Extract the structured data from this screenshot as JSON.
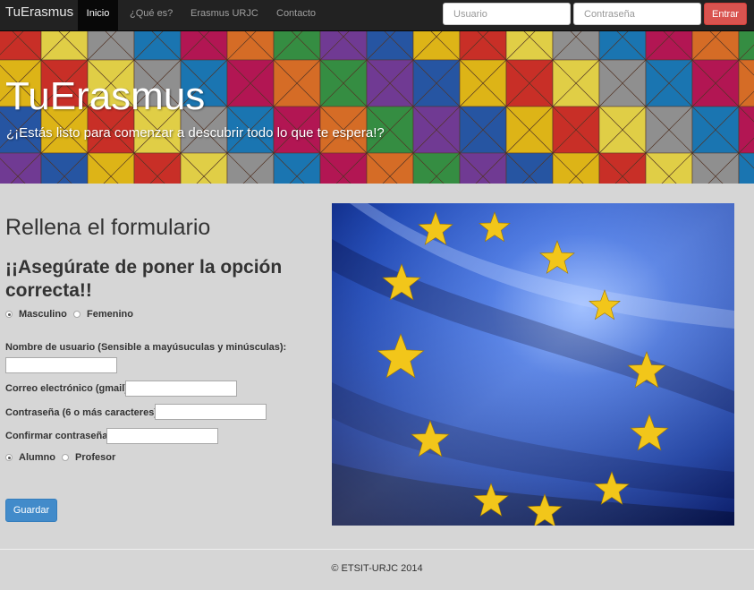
{
  "navbar": {
    "brand": "TuErasmus",
    "items": [
      {
        "label": "Inicio",
        "active": true
      },
      {
        "label": "¿Qué es?",
        "active": false
      },
      {
        "label": "Erasmus URJC",
        "active": false
      },
      {
        "label": "Contacto",
        "active": false
      }
    ],
    "user_placeholder": "Usuario",
    "password_placeholder": "Contraseña",
    "login_button": "Entrar"
  },
  "hero": {
    "title": "TuErasmus",
    "subtitle": "¿¡Estás listo para comenzar a descubrir todo lo que te espera!?"
  },
  "form": {
    "heading": "Rellena el formulario",
    "warning": "¡¡Asegúrate de poner la opción correcta!!",
    "gender_options": [
      {
        "label": "Masculino",
        "checked": true
      },
      {
        "label": "Femenino",
        "checked": false
      }
    ],
    "username_label": "Nombre de usuario (Sensible a mayúsuculas y minúsculas):",
    "email_label": "Correo electrónico (gmail):",
    "password_label": "Contraseña (6 o más caracteres):",
    "confirm_label": "Confirmar contraseña:",
    "role_options": [
      {
        "label": "Alumno",
        "checked": true
      },
      {
        "label": "Profesor",
        "checked": false
      }
    ],
    "save_button": "Guardar"
  },
  "footer": {
    "text": "© ETSIT-URJC 2014"
  },
  "colors": {
    "navbar_bg": "#222222",
    "login_button": "#d9534f",
    "save_button": "#428bca",
    "page_bg": "#d6d6d6",
    "flag_blue": "#1f4fb8",
    "flag_star": "#f2c61a"
  }
}
